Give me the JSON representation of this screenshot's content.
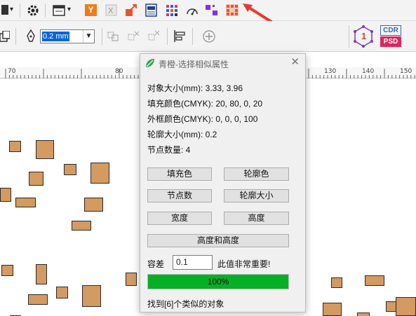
{
  "dialog": {
    "title": "青橙-选择相似属性",
    "close": "✕",
    "info": {
      "size": "对象大小(mm): 3.33, 3.96",
      "fill": "填充颜色(CMYK): 20, 80, 0, 20",
      "outline": "外框颜色(CMYK): 0, 0, 0, 100",
      "outline_size": "轮廓大小(mm): 0.2",
      "nodes": "节点数量: 4"
    },
    "buttons": {
      "fill": "填充色",
      "outline": "轮廓色",
      "nodes": "节点数",
      "outline_size": "轮廓大小",
      "width": "宽度",
      "height": "高度",
      "width_height": "高度和高度"
    },
    "tolerance": {
      "label": "容差",
      "value": "0.1",
      "note": "此值非常重要!"
    },
    "progress": {
      "percent": 100,
      "label": "100%"
    },
    "status": "找到[6]个类似的对象"
  },
  "toolbar": {
    "outline_width": "0.2 mm",
    "cdr_psd_label_top": "CDR",
    "cdr_psd_label_bottom": "PSD",
    "badge_number": "1",
    "app_letter": "Y"
  },
  "ruler": {
    "labels": [
      "70",
      "80",
      "130",
      "140",
      "150"
    ]
  },
  "colors": {
    "shape_fill": "#d39a62",
    "progress_fill": "#06b025",
    "accent_arrow": "#e83a2e"
  }
}
